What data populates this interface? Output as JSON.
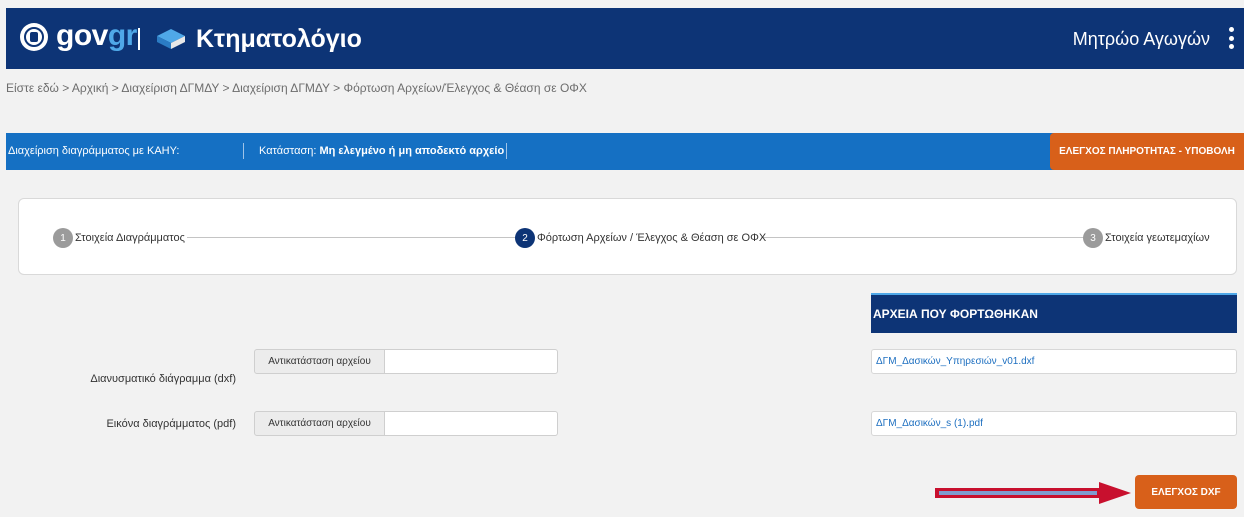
{
  "header": {
    "brand_gov": "gov",
    "brand_gr": "gr",
    "app_title": "Κτηματολόγιο",
    "registry_link": "Μητρώο Αγωγών",
    "colors": {
      "bar": "#0d3476",
      "accent": "#4fa8e8"
    }
  },
  "breadcrumb": "Είστε εδώ > Αρχική > Διαχείριση ΔΓΜΔΥ > Διαχείριση ΔΓΜΔΥ > Φόρτωση Αρχείων/Έλεγχος & Θέαση σε ΟΦΧ",
  "status": {
    "diagram_label": "Διαχείριση διαγράμματος με ΚΑΗΥ:",
    "state_label": "Κατάσταση:",
    "state_value": "Μη ελεγμένο ή μη αποδεκτό αρχείο",
    "submit_button": "ΕΛΕΓΧΟΣ ΠΛΗΡΟΤΗΤΑΣ - ΥΠΟΒΟΛΗ",
    "colors": {
      "bar": "#1570c3",
      "button": "#d8601a"
    }
  },
  "steps": [
    {
      "number": "1",
      "label": "Στοιχεία Διαγράμματος",
      "active": false
    },
    {
      "number": "2",
      "label": "Φόρτωση Αρχείων / Έλεγχος & Θέαση σε ΟΦΧ",
      "active": true
    },
    {
      "number": "3",
      "label": "Στοιχεία γεωτεμαχίων",
      "active": false
    }
  ],
  "files": {
    "header": "ΑΡΧΕΙΑ ΠΟΥ ΦΟΡΤΩΘΗΚΑΝ",
    "rows": [
      {
        "label": "Διανυσματικό διάγραμμα (dxf)",
        "button": "Αντικατάσταση αρχείου",
        "value": "",
        "uploaded": "ΔΓΜ_Δασικών_Υπηρεσιών_v01.dxf"
      },
      {
        "label": "Εικόνα διαγράμματος (pdf)",
        "button": "Αντικατάσταση αρχείου",
        "value": "",
        "uploaded": "ΔΓΜ_Δασικών_s (1).pdf"
      }
    ]
  },
  "check_button": "ΕΛΕΓΧΟΣ DXF",
  "icons": [
    "greek-seal-icon",
    "ktimatologio-logo-icon",
    "kebab-menu-icon",
    "red-arrow-icon"
  ]
}
